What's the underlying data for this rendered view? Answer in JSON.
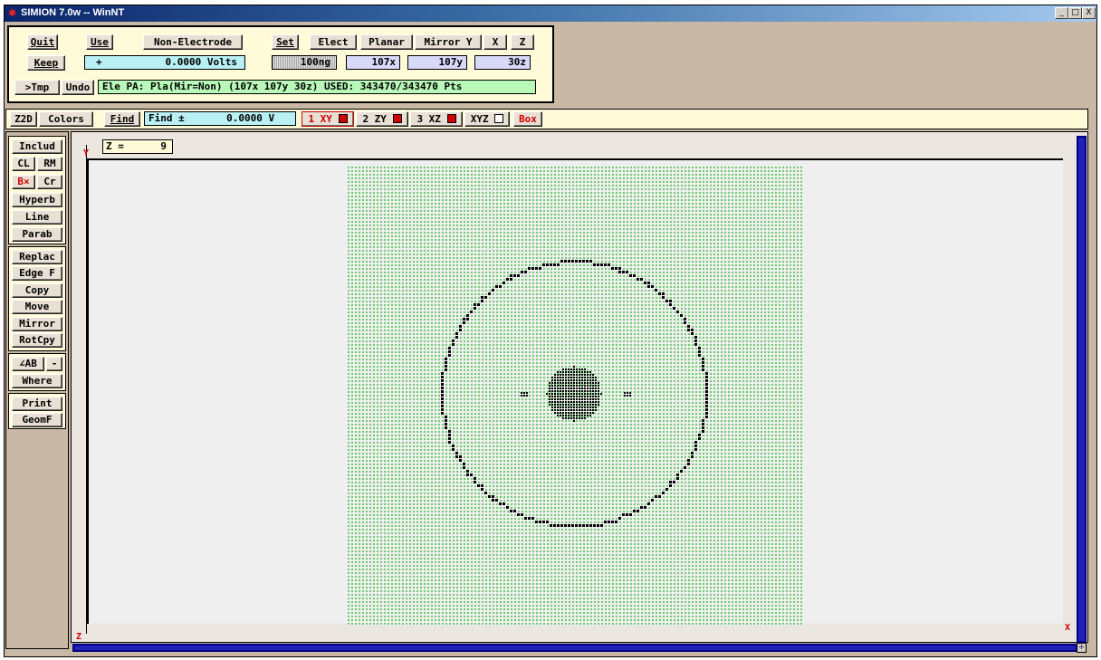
{
  "window": {
    "title": "SIMION 7.0w -- WinNT",
    "controls": [
      "_",
      "□",
      "X"
    ]
  },
  "top_panel": {
    "quit_label": "Quit",
    "keep_label": "Keep",
    "use_label": "Use",
    "non_electrode_label": "Non-Electrode",
    "volts_sign": "+",
    "volts_value": "0.0000 Volts",
    "set_label": "Set",
    "elect_label": "Elect",
    "planar_label": "Planar",
    "mirror_y_label": "Mirror Y",
    "x_label": "X",
    "z_label": "Z",
    "ng_value": "100ng",
    "x_size": "107x",
    "y_size": "107y",
    "z_size": "30z",
    "tmp_label": ">Tmp",
    "undo_label": "Undo",
    "status": "Ele PA: Pla(Mir=Non) (107x 107y 30z)  USED: 343470/343470 Pts"
  },
  "toolbar": {
    "z2d_label": "Z2D",
    "colors_label": "Colors",
    "find_label": "Find",
    "find_field": "Find ±       0.0000 V",
    "view1": "1 XY",
    "view2": "2 ZY",
    "view3": "3 XZ",
    "view4": "XYZ",
    "box_label": "Box"
  },
  "left_tools": {
    "group1": [
      "Includ",
      "CL",
      "RM",
      "B×",
      "Cr",
      "Hyperb",
      "Line",
      "Parab"
    ],
    "group2": [
      "Replac",
      "Edge F",
      "Copy",
      "Move",
      "Mirror",
      "RotCpy"
    ],
    "group3": [
      "∠AB",
      "-",
      "Where"
    ],
    "group4": [
      "Print",
      "GeomF"
    ]
  },
  "view": {
    "z_label": "Z =",
    "z_value": "9",
    "axis_y": "Y",
    "axis_x": "X",
    "axis_z": "Z"
  },
  "colors": {
    "grid_dot": "#3fbf3f",
    "electrode": "#000000",
    "accent_red": "#d00000",
    "scroll": "#2020b8"
  }
}
